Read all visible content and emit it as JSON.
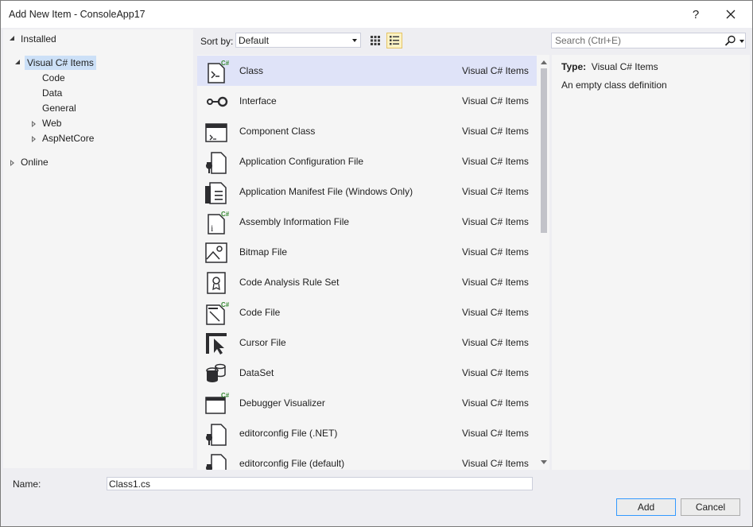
{
  "window": {
    "title": "Add New Item - ConsoleApp17",
    "help_label": "?",
    "close_label": "✕"
  },
  "tree": {
    "installed": "Installed",
    "visual_csharp": "Visual C# Items",
    "code": "Code",
    "data": "Data",
    "general": "General",
    "web": "Web",
    "aspnetcore": "AspNetCore",
    "online": "Online"
  },
  "toolbar": {
    "sort_label": "Sort by:",
    "sort_value": "Default",
    "search_placeholder": "Search (Ctrl+E)"
  },
  "items": [
    {
      "name": "Class",
      "category": "Visual C# Items",
      "icon": "class-icon",
      "selected": true
    },
    {
      "name": "Interface",
      "category": "Visual C# Items",
      "icon": "interface-icon"
    },
    {
      "name": "Component Class",
      "category": "Visual C# Items",
      "icon": "component-class-icon"
    },
    {
      "name": "Application Configuration File",
      "category": "Visual C# Items",
      "icon": "config-file-icon"
    },
    {
      "name": "Application Manifest File (Windows Only)",
      "category": "Visual C# Items",
      "icon": "manifest-file-icon"
    },
    {
      "name": "Assembly Information File",
      "category": "Visual C# Items",
      "icon": "assembly-info-icon"
    },
    {
      "name": "Bitmap File",
      "category": "Visual C# Items",
      "icon": "bitmap-file-icon"
    },
    {
      "name": "Code Analysis Rule Set",
      "category": "Visual C# Items",
      "icon": "rule-set-icon"
    },
    {
      "name": "Code File",
      "category": "Visual C# Items",
      "icon": "code-file-icon"
    },
    {
      "name": "Cursor File",
      "category": "Visual C# Items",
      "icon": "cursor-file-icon"
    },
    {
      "name": "DataSet",
      "category": "Visual C# Items",
      "icon": "dataset-icon"
    },
    {
      "name": "Debugger Visualizer",
      "category": "Visual C# Items",
      "icon": "debugger-visualizer-icon"
    },
    {
      "name": "editorconfig File (.NET)",
      "category": "Visual C# Items",
      "icon": "editorconfig-icon"
    },
    {
      "name": "editorconfig File (default)",
      "category": "Visual C# Items",
      "icon": "editorconfig-icon"
    }
  ],
  "details": {
    "type_label": "Type:",
    "type_value": "Visual C# Items",
    "description": "An empty class definition"
  },
  "footer": {
    "name_label": "Name:",
    "name_value": "Class1.cs",
    "add_label": "Add",
    "cancel_label": "Cancel"
  },
  "colors": {
    "selection": "#dfe3f8",
    "tree_selection": "#cce0f7",
    "csharp_green": "#388a34",
    "icon_dark": "#2d2d30"
  }
}
